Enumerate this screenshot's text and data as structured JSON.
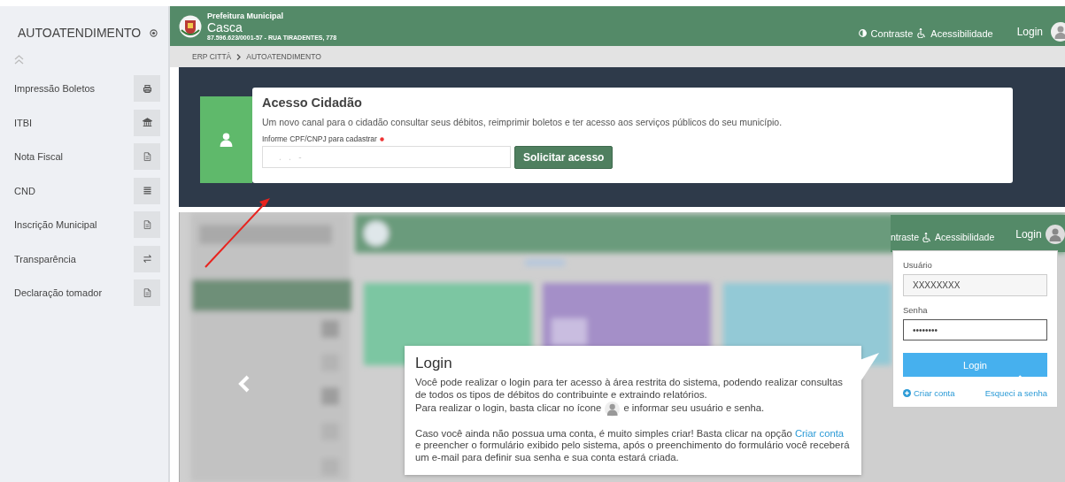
{
  "sidebar": {
    "title": "AUTOATENDIMENTO",
    "items": [
      {
        "label": "Impressão Boletos"
      },
      {
        "label": "ITBI"
      },
      {
        "label": "Nota Fiscal"
      },
      {
        "label": "CND"
      },
      {
        "label": "Inscrição Municipal"
      },
      {
        "label": "Transparência"
      },
      {
        "label": "Declaração tomador"
      }
    ]
  },
  "header": {
    "org_label": "Prefeitura Municipal",
    "city": "Casca",
    "address": "87.596.623/0001-57 - RUA TIRADENTES, 778",
    "contrast": "Contraste",
    "accessibility": "Acessibilidade",
    "login": "Login"
  },
  "breadcrumb": [
    "ERP CITTÀ",
    "AUTOATENDIMENTO"
  ],
  "access_card": {
    "title": "Acesso Cidadão",
    "description": "Um novo canal para o cidadão consultar seus débitos, reimprimir boletos e ter acesso aos serviços públicos do seu município.",
    "field_label": "Informe CPF/CNPJ para cadastrar",
    "required": true,
    "placeholder": ".   .   -",
    "button": "Solicitar acesso"
  },
  "tutorial_slide": {
    "header": {
      "contrast": "ntraste",
      "accessibility": "Acessibilidade",
      "login": "Login"
    },
    "login_form": {
      "username_label": "Usuário",
      "username_value": "XXXXXXXX",
      "password_label": "Senha",
      "password_value": "••••••••",
      "button": "Login",
      "create_account": "Criar conta",
      "forgot_password": "Esqueci a senha"
    },
    "callout": {
      "title": "Login",
      "intro": "Você pode realizar o login para ter acesso à área restrita do sistema, podendo realizar consultas de todos os tipos de débitos do contribuinte e extraindo relatórios.",
      "instruction_before": "Para realizar o login, basta clicar no ícone",
      "instruction_after": "e informar seu usuário e senha.",
      "signup_before": "Caso você ainda não possua uma conta, é muito simples criar! Basta clicar na opção",
      "signup_link": "Criar conta",
      "signup_after": "e preencher o formulário exibido pelo sistema, após o preenchimento do formulário você receberá um e-mail para definir sua senha e sua conta estará criada."
    }
  }
}
